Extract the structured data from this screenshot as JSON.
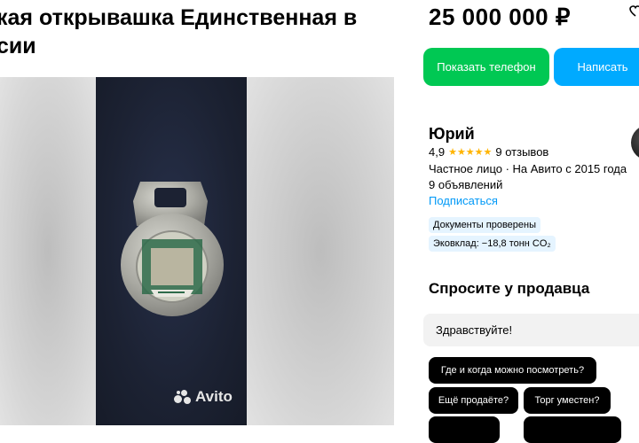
{
  "listing": {
    "title": "кая открывашка Единственная в\nсии",
    "price": "25 000 000 ₽"
  },
  "gallery": {
    "watermark": "Avito"
  },
  "actions": {
    "phone_label": "Показать телефон",
    "write_label": "Написать"
  },
  "seller": {
    "name": "Юрий",
    "rating": "4,9",
    "stars": "★★★★★",
    "reviews": "9 отзывов",
    "type": "Частное лицо · На Авито с 2015 года",
    "ads_count": "9 объявлений",
    "subscribe_label": "Подписаться",
    "badge_docs": "Документы проверены",
    "badge_eco": "Эковклад: −18,8 тонн CO₂"
  },
  "ask": {
    "title": "Спросите у продавца",
    "input_value": "Здравствуйте!",
    "chips": [
      "Где и когда можно посмотреть?",
      "Ещё продаёте?",
      "Торг уместен?",
      "",
      ""
    ]
  },
  "colors": {
    "phone_button": "#00c853",
    "write_button": "#00aaff",
    "link": "#0099f7",
    "star": "#ffb400"
  }
}
